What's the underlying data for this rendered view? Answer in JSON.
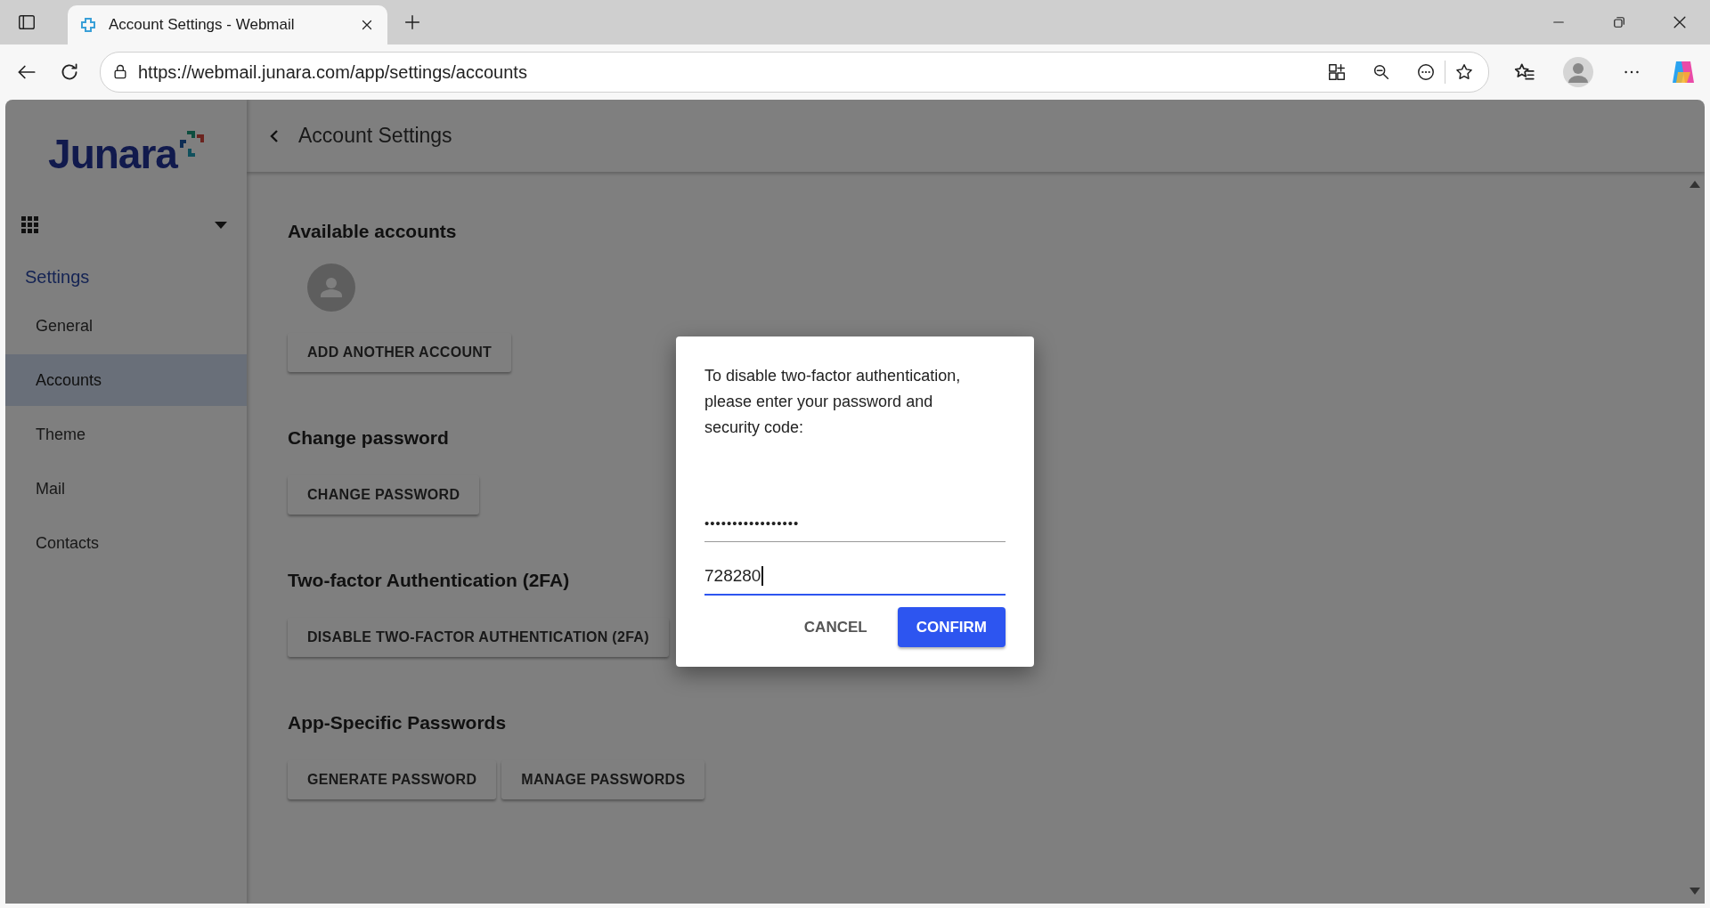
{
  "browser": {
    "tab_title": "Account Settings - Webmail",
    "url": "https://webmail.junara.com/app/settings/accounts"
  },
  "sidebar": {
    "logo": "Junara",
    "section_title": "Settings",
    "items": [
      {
        "label": "General",
        "selected": false
      },
      {
        "label": "Accounts",
        "selected": true
      },
      {
        "label": "Theme",
        "selected": false
      },
      {
        "label": "Mail",
        "selected": false
      },
      {
        "label": "Contacts",
        "selected": false
      }
    ]
  },
  "header": {
    "title": "Account Settings"
  },
  "sections": [
    {
      "heading": "Available accounts",
      "kind": "accounts",
      "buttons": [
        "ADD ANOTHER ACCOUNT"
      ]
    },
    {
      "heading": "Change password",
      "kind": "plain",
      "buttons": [
        "CHANGE PASSWORD"
      ]
    },
    {
      "heading": "Two-factor Authentication (2FA)",
      "kind": "plain",
      "buttons": [
        "DISABLE TWO-FACTOR AUTHENTICATION (2FA)"
      ]
    },
    {
      "heading": "App-Specific Passwords",
      "kind": "plain",
      "buttons": [
        "GENERATE PASSWORD",
        "MANAGE PASSWORDS"
      ]
    }
  ],
  "dialog": {
    "message": "To disable two-factor authentication, please enter your password and security code:",
    "fields": [
      {
        "kind": "password",
        "value": "•••••••••••••••••",
        "focused": false
      },
      {
        "kind": "code",
        "value": "728280",
        "focused": true
      }
    ],
    "cancel": "CANCEL",
    "confirm": "CONFIRM"
  }
}
